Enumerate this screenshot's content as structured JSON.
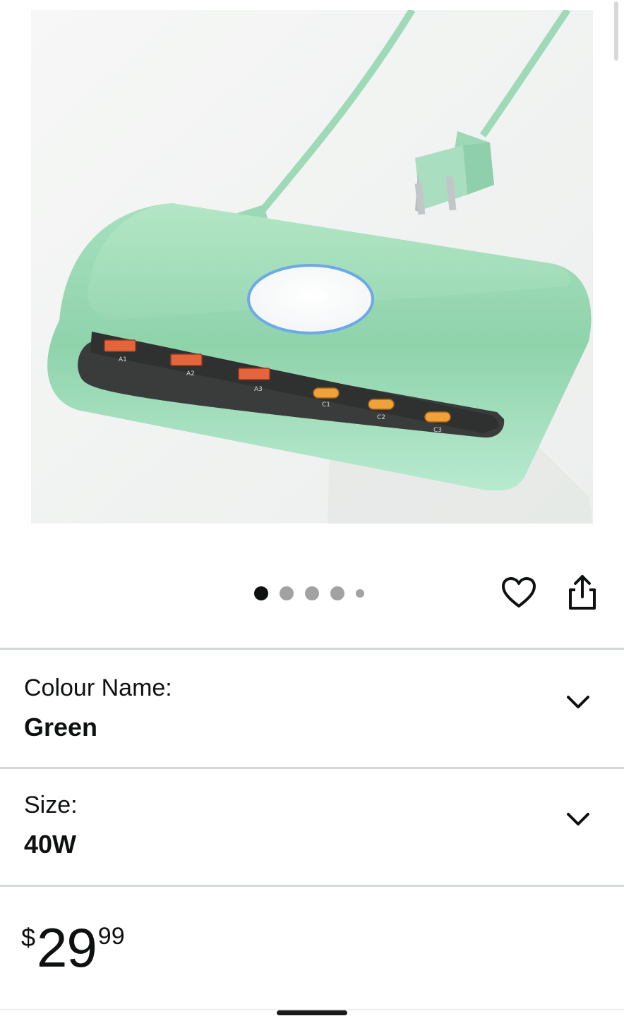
{
  "product": {
    "image_alt": "Green multi-port USB charging station with wireless charging pad and power cord",
    "port_labels": [
      "A1",
      "A2",
      "A3",
      "C1",
      "C2",
      "C3"
    ]
  },
  "carousel": {
    "dot_count": 5,
    "active_index": 0
  },
  "actions": {
    "wishlist_icon": "heart-icon",
    "share_icon": "share-icon"
  },
  "variations": {
    "colour": {
      "label": "Colour Name:",
      "value": "Green"
    },
    "size": {
      "label": "Size:",
      "value": "40W"
    }
  },
  "price": {
    "symbol": "$",
    "whole": "29",
    "fraction": "99"
  },
  "colors": {
    "product_green": "#9fdcb8",
    "divider": "#d5d9d9",
    "text": "#0f1111",
    "dot_inactive": "#a2a2a2",
    "charging_ring": "#6ea9e6",
    "port_orange": "#e4653c"
  }
}
